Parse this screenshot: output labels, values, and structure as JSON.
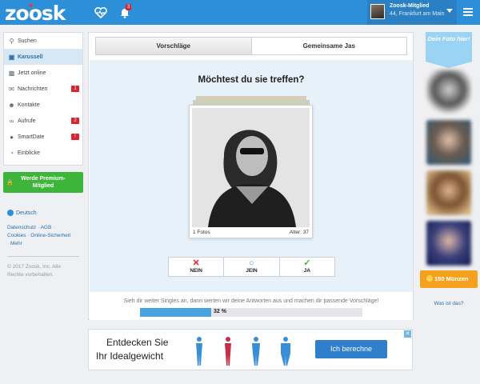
{
  "topbar": {
    "logo": "zoosk",
    "notification_count": "3",
    "profile_name": "Zoosk-Mitglied",
    "profile_location": "44, Frankfurt am Main"
  },
  "sidebar": {
    "items": [
      {
        "label": "Suchen",
        "icon": "search-icon",
        "badge": ""
      },
      {
        "label": "Karussell",
        "icon": "carousel-icon",
        "badge": ""
      },
      {
        "label": "Jetzt online",
        "icon": "online-icon",
        "badge": ""
      },
      {
        "label": "Nachrichten",
        "icon": "mail-icon",
        "badge": "1"
      },
      {
        "label": "Kontakte",
        "icon": "contacts-icon",
        "badge": ""
      },
      {
        "label": "Aufrufe",
        "icon": "glasses-icon",
        "badge": "2"
      },
      {
        "label": "SmartDate",
        "icon": "smartdate-icon",
        "badge": "!"
      },
      {
        "label": "Einblicke",
        "icon": "insights-icon",
        "badge": ""
      }
    ],
    "premium_label": "Werde Premium-Mitglied",
    "language": "Deutsch",
    "links": [
      "Datenschutz",
      "AGB",
      "Cookies",
      "Online-Sicherheit",
      "Mehr"
    ],
    "copyright": "© 2017 Zoosk, Inc. Alle Rechte vorbehalten."
  },
  "main": {
    "tabs": [
      "Vorschläge",
      "Gemeinsame Jas"
    ],
    "question": "Möchtest du sie treffen?",
    "photo_count": "1 Fotos",
    "age": "Alter: 37",
    "vote": {
      "no": "NEIN",
      "maybe": "JEIN",
      "yes": "JA"
    },
    "hint": "Sieh dir weiter Singles an, dann werten wir deine Antworten aus und machen dir passende Vorschläge!",
    "progress_label": "32 %",
    "progress_value": 0.32
  },
  "ad": {
    "line1": "Entdecken Sie",
    "line2": "Ihr Idealgewicht",
    "button": "Ich berechne"
  },
  "rightcol": {
    "banner": "Dein Foto hier!",
    "coins_label": "150 Münzen",
    "help_link": "Was ist das?"
  },
  "colors": {
    "brand_blue": "#2c8fd7",
    "premium_green": "#3db53a",
    "coins_orange": "#f4a21e",
    "badge_red": "#d9232e"
  }
}
